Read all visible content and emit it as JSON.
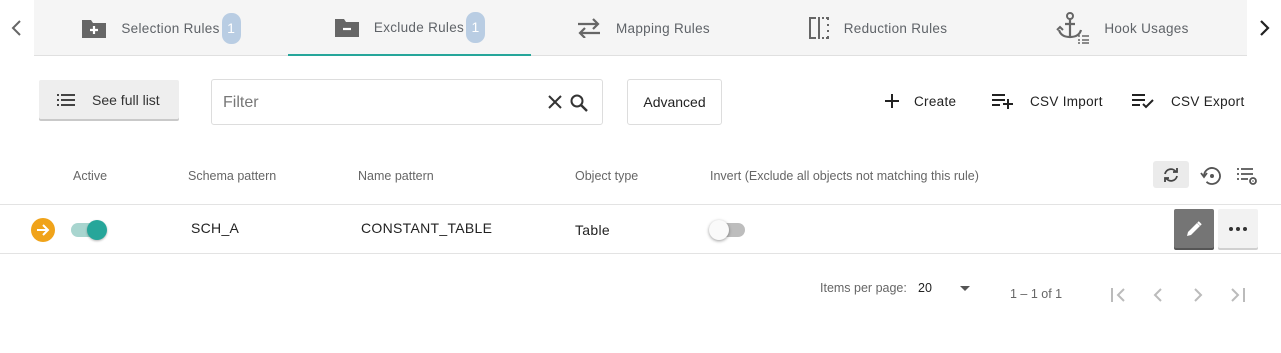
{
  "tabs": [
    {
      "label": "Selection Rules",
      "badge": "1",
      "icon": "folder-plus-icon",
      "active": false
    },
    {
      "label": "Exclude Rules",
      "badge": "1",
      "icon": "folder-minus-icon",
      "active": true
    },
    {
      "label": "Mapping Rules",
      "icon": "swap-arrows-icon",
      "active": false
    },
    {
      "label": "Reduction Rules",
      "icon": "split-column-icon",
      "active": false
    },
    {
      "label": "Hook Usages",
      "icon": "anchor-list-icon",
      "active": false
    }
  ],
  "toolbar": {
    "see_full_list": "See full list",
    "filter_placeholder": "Filter",
    "filter_value": "",
    "advanced": "Advanced",
    "create": "Create",
    "csv_import": "CSV Import",
    "csv_export": "CSV Export"
  },
  "table": {
    "headers": {
      "active": "Active",
      "schema_pattern": "Schema pattern",
      "name_pattern": "Name pattern",
      "object_type": "Object type",
      "invert": "Invert (Exclude all objects not matching this rule)"
    },
    "rows": [
      {
        "active": true,
        "schema_pattern": "SCH_A",
        "name_pattern": "CONSTANT_TABLE",
        "object_type": "Table",
        "invert": false
      }
    ]
  },
  "paginator": {
    "items_per_page_label": "Items per page:",
    "items_per_page": "20",
    "range": "1 – 1 of 1"
  },
  "colors": {
    "accent": "#26a69a",
    "badge": "#b9cde3",
    "row_arrow": "#f0a31a",
    "edit_button": "#757575"
  }
}
